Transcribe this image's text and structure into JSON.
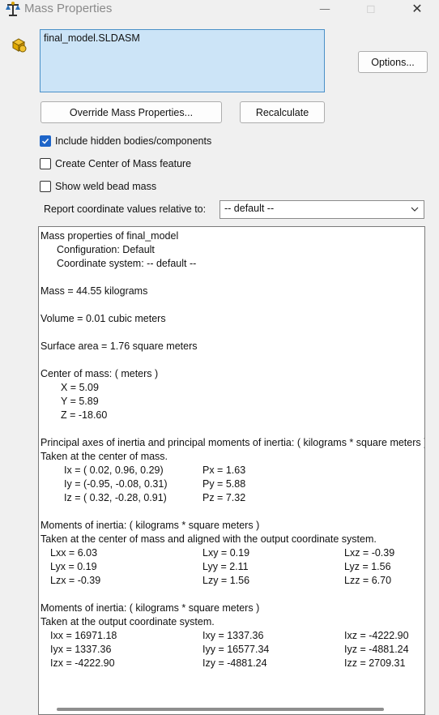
{
  "window": {
    "title": "Mass Properties",
    "minimize": "—",
    "maximize": "☐",
    "close": "✕"
  },
  "selection": {
    "item": "final_model.SLDASM"
  },
  "buttons": {
    "options": "Options...",
    "override": "Override Mass Properties...",
    "recalculate": "Recalculate"
  },
  "checkboxes": [
    {
      "label": "Include hidden bodies/components",
      "checked": true
    },
    {
      "label": "Create Center of Mass feature",
      "checked": false
    },
    {
      "label": "Show weld bead mass",
      "checked": false
    }
  ],
  "report": {
    "label": "Report coordinate values relative to:",
    "value": "-- default --"
  },
  "results": {
    "header": "Mass properties of final_model",
    "configuration": "Configuration: Default",
    "coord_system": "Coordinate system: -- default --",
    "mass": "Mass = 44.55 kilograms",
    "volume": "Volume = 0.01 cubic meters",
    "surface_area": "Surface area = 1.76 square meters",
    "com_title": "Center of mass: ( meters )",
    "com": [
      "X = 5.09",
      "Y = 5.89",
      "Z = -18.60"
    ],
    "principal_title": "Principal axes of inertia and principal moments of inertia: ( kilograms * square meters )",
    "principal_sub": "Taken at the center of mass.",
    "principal_axes": [
      "Ix = ( 0.02,  0.96,  0.29)",
      "Iy = (-0.95, -0.08,  0.31)",
      "Iz = ( 0.32, -0.28,  0.91)"
    ],
    "principal_moments": [
      "Px = 1.63",
      "Py = 5.88",
      "Pz = 7.32"
    ],
    "moi_com_title": "Moments of inertia: ( kilograms * square meters )",
    "moi_com_sub": "Taken at the center of mass and aligned with the output coordinate system.",
    "moi_com": [
      [
        "Lxx = 6.03",
        "Lxy = 0.19",
        "Lxz = -0.39"
      ],
      [
        "Lyx = 0.19",
        "Lyy = 2.11",
        "Lyz = 1.56"
      ],
      [
        "Lzx = -0.39",
        "Lzy = 1.56",
        "Lzz = 6.70"
      ]
    ],
    "moi_out_title": "Moments of inertia: ( kilograms * square meters )",
    "moi_out_sub": "Taken at the output coordinate system.",
    "moi_out": [
      [
        "Ixx = 16971.18",
        "Ixy = 1337.36",
        "Ixz = -4222.90"
      ],
      [
        "Iyx = 1337.36",
        "Iyy = 16577.34",
        "Iyz = -4881.24"
      ],
      [
        "Izx = -4222.90",
        "Izy = -4881.24",
        "Izz = 2709.31"
      ]
    ]
  }
}
